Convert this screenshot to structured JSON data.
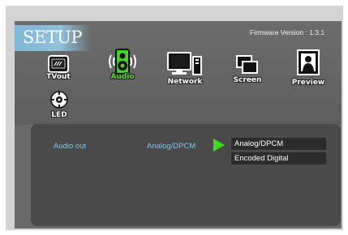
{
  "header": {
    "title": "SETUP",
    "firmware": "Firmware Version : 1.3.1"
  },
  "nav": {
    "items": [
      {
        "label": "TVout",
        "icon": "tv-out-icon"
      },
      {
        "label": "Audio",
        "icon": "speaker-icon",
        "active": true
      },
      {
        "label": "Network",
        "icon": "network-computer-icon"
      },
      {
        "label": "Screen",
        "icon": "screen-windows-icon"
      },
      {
        "label": "Preview",
        "icon": "preview-person-icon"
      },
      {
        "label": "LED",
        "icon": "led-icon"
      }
    ]
  },
  "panel": {
    "setting_label": "Audio out",
    "setting_value": "Analog/DPCM",
    "options": [
      "Analog/DPCM",
      "Encoded Digital"
    ]
  },
  "colors": {
    "accent_green": "#3edb23",
    "label_blue": "#7ec6e6",
    "title_band": "#8fc2dc"
  }
}
